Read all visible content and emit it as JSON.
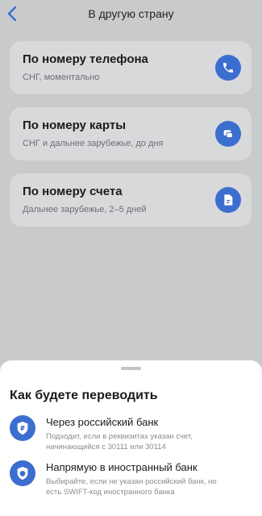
{
  "header": {
    "title": "В другую страну",
    "back_icon": "chevron-left-icon"
  },
  "colors": {
    "accent": "#3c6ed0",
    "background_dimmed": "#c9cacc",
    "sheet": "#ffffff"
  },
  "methods": [
    {
      "title": "По номеру телефона",
      "subtitle": "СНГ, моментально",
      "icon": "phone-icon"
    },
    {
      "title": "По номеру карты",
      "subtitle": "СНГ и дальнее зарубежье, до дня",
      "icon": "card-transfer-icon"
    },
    {
      "title": "По номеру счета",
      "subtitle": "Дальнее зарубежье, 2–5 дней",
      "icon": "document-icon"
    }
  ],
  "sheet": {
    "title": "Как будете переводить",
    "options": [
      {
        "title": "Через российский банк",
        "description": "Подходит, если в реквизитах указан счет, начинающийся с 30111 или 30114",
        "icon": "ruble-shield-icon"
      },
      {
        "title": "Напрямую в иностранный банк",
        "description": "Выбирайте, если не указан российский банк, но есть SWIFT-код иностранного банка",
        "icon": "bank-shield-icon"
      }
    ]
  }
}
